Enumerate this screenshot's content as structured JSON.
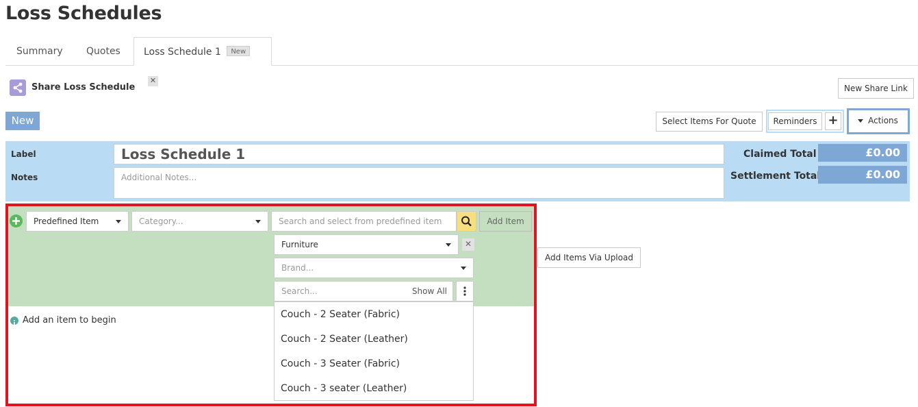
{
  "page": {
    "title": "Loss Schedules"
  },
  "tabs": [
    {
      "label": "Summary"
    },
    {
      "label": "Quotes"
    },
    {
      "label": "Loss Schedule 1",
      "badge": "New",
      "close": "✕"
    }
  ],
  "share": {
    "label": "Share Loss Schedule",
    "new_link_button": "New Share Link"
  },
  "toolbar": {
    "new_button": "New",
    "select_items_button": "Select Items For Quote",
    "reminders_button": "Reminders",
    "add_reminder_button": "+",
    "actions_button": "Actions"
  },
  "form": {
    "label_caption": "Label",
    "label_value": "Loss Schedule 1",
    "notes_caption": "Notes",
    "notes_placeholder": "Additional Notes...",
    "claimed_total_caption": "Claimed Total",
    "claimed_total_value": "£0.00",
    "settlement_total_caption": "Settlement Total",
    "settlement_total_value": "£0.00"
  },
  "item_entry": {
    "item_type_value": "Predefined Item",
    "category_placeholder": "Category...",
    "search_placeholder": "Search and select from predefined item",
    "add_item_button": "Add Item",
    "add_via_upload_button": "Add Items Via Upload",
    "empty_message": "Add an item to begin"
  },
  "picker": {
    "category_value": "Furniture",
    "brand_placeholder": "Brand...",
    "search_placeholder": "Search...",
    "show_all_label": "Show All",
    "items": [
      {
        "label": "Couch - 2 Seater (Fabric)"
      },
      {
        "label": "Couch - 2 Seater (Leather)"
      },
      {
        "label": "Couch - 3 Seater (Fabric)"
      },
      {
        "label": "Couch - 3 seater (Leather)"
      }
    ]
  },
  "colors": {
    "accent_blue": "#7ea7d6",
    "panel_blue": "#b9dcf4",
    "panel_green": "#c3dfbf",
    "highlight_red": "#e0141e",
    "search_yellow": "#f5df7f",
    "share_purple": "#a99bd8"
  },
  "icons": {
    "share": "share-icon",
    "add_row": "plus-circle-icon",
    "search": "search-icon",
    "info": "info-icon",
    "more": "kebab-menu-icon",
    "clear": "close-icon"
  }
}
